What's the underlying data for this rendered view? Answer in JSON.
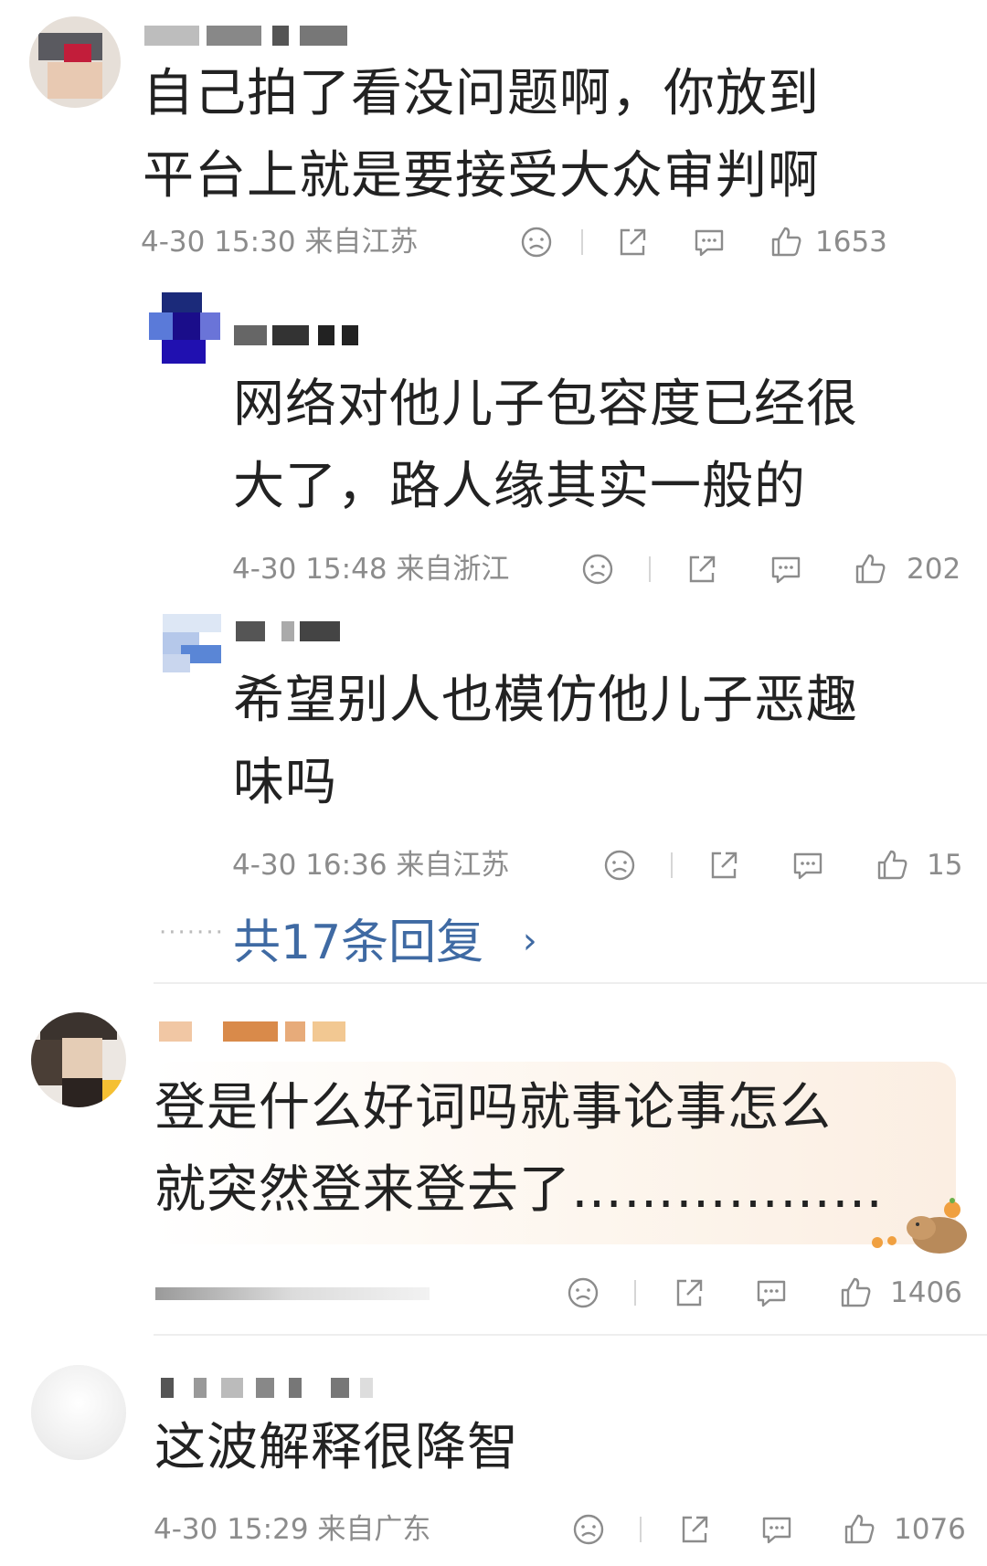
{
  "colors": {
    "text": "#222222",
    "meta": "#8c8c8c",
    "link": "#3f6aa3"
  },
  "comments": [
    {
      "text": "自己拍了看没问题啊，你放到\n平台上就是要接受大众审判啊",
      "time": "4-30 15:30 来自江苏",
      "likes": "1653"
    },
    {
      "text": "网络对他儿子包容度已经很\n大了，路人缘其实一般的",
      "time": "4-30 15:48 来自浙江",
      "likes": "202"
    },
    {
      "text": "希望别人也模仿他儿子恶趣\n味吗",
      "time": "4-30 16:36 来自江苏",
      "likes": "15"
    },
    {
      "text": "登是什么好词吗就事论事怎么\n就突然登来登去了………………",
      "time": "",
      "likes": "1406"
    },
    {
      "text": "这波解释很降智",
      "time": "4-30 15:29 来自广东",
      "likes": "1076"
    }
  ],
  "replies_link": {
    "label": "共17条回复",
    "chevron": "›"
  },
  "icons": [
    "sad-face-icon",
    "share-icon",
    "comment-icon",
    "thumbs-up-icon"
  ]
}
